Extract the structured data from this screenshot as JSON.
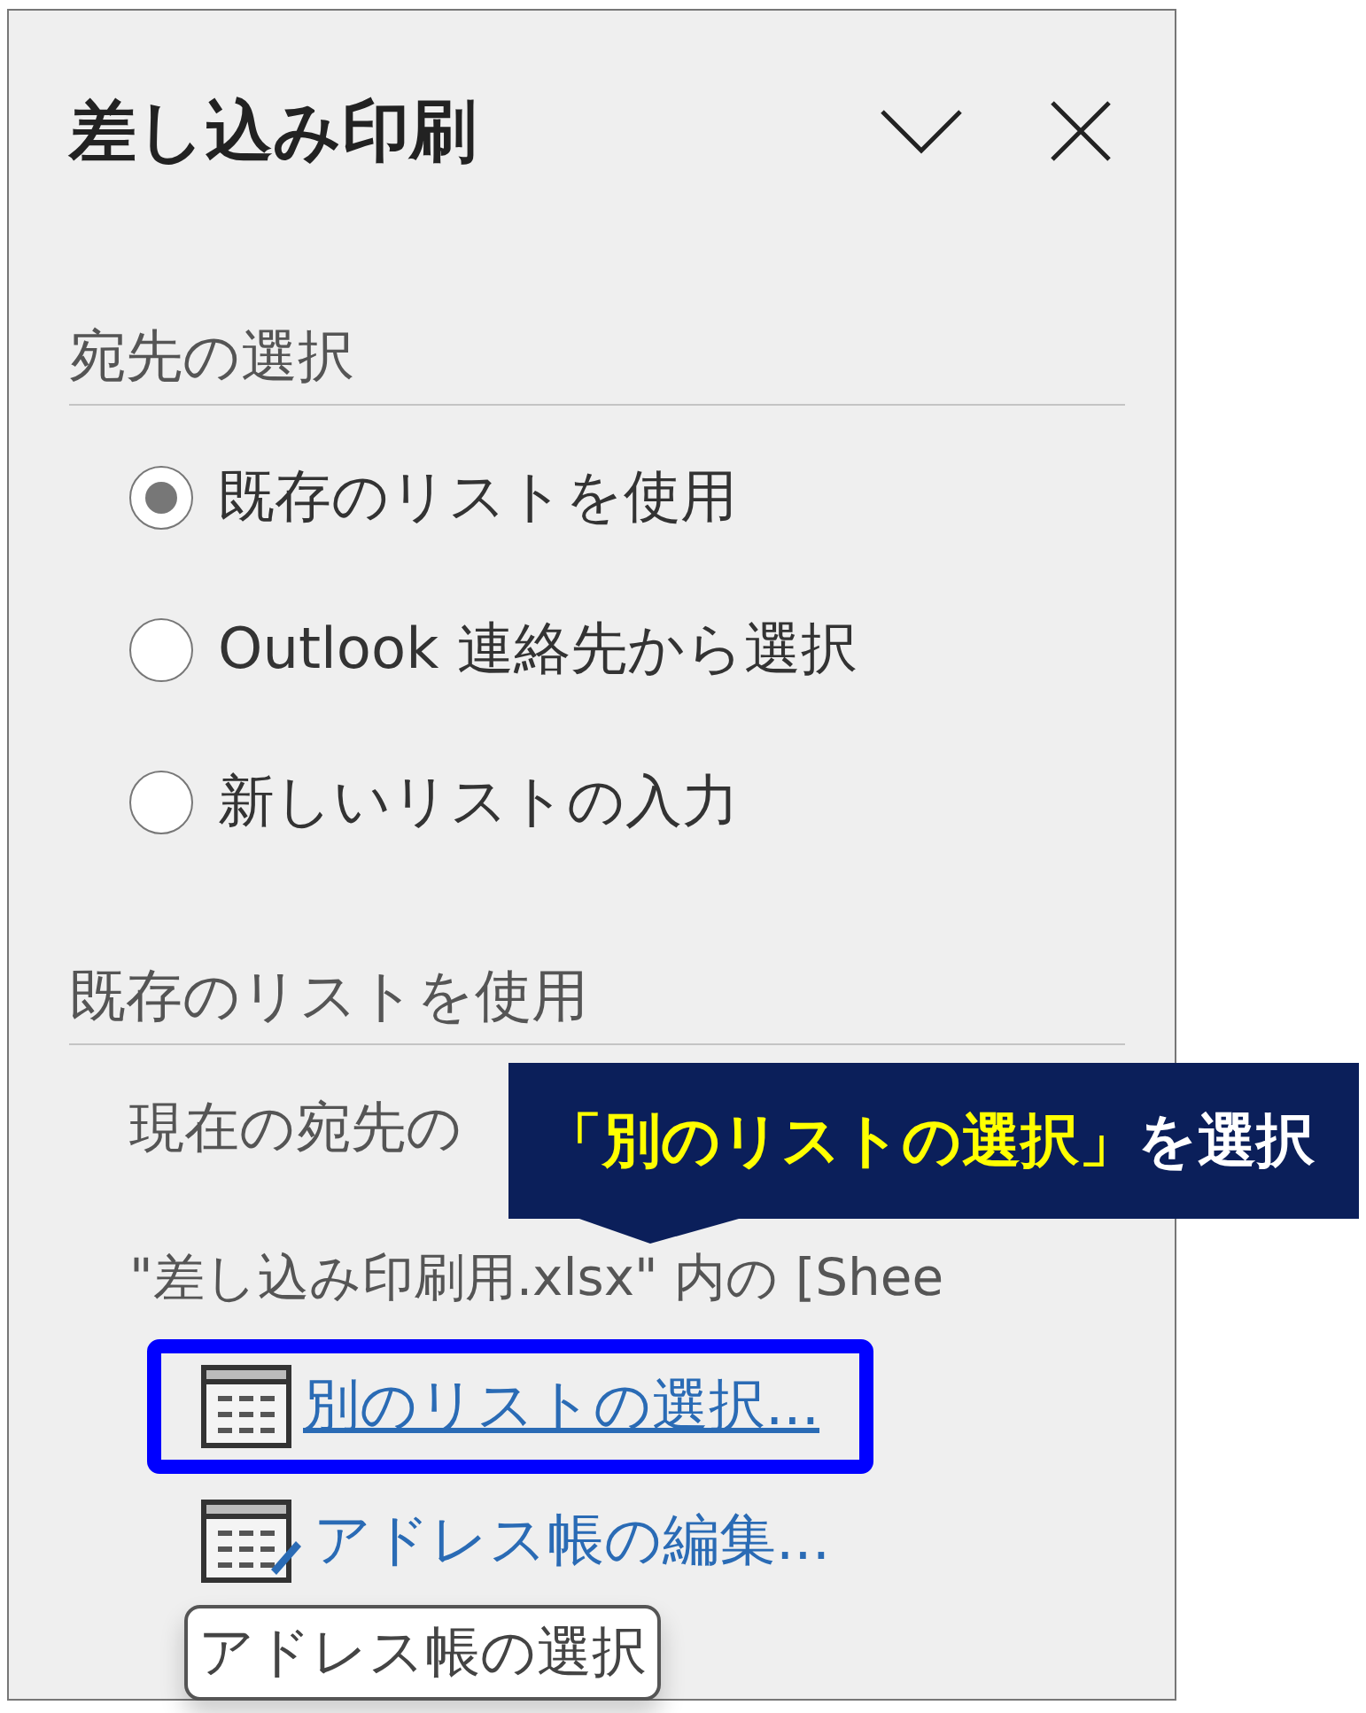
{
  "pane": {
    "title": "差し込み印刷"
  },
  "recipient_section": {
    "heading": "宛先の選択",
    "options": [
      {
        "label": "既存のリストを使用",
        "selected": true
      },
      {
        "label": "Outlook 連絡先から選択",
        "selected": false
      },
      {
        "label": "新しいリストの入力",
        "selected": false
      }
    ]
  },
  "list_section": {
    "heading": "既存のリストを使用",
    "lines": [
      "現在の宛先の",
      "\"差し込み印刷用.xlsx\" 内の [Shee"
    ],
    "links": [
      {
        "kind": "select",
        "label": "別のリストの選択...",
        "highlighted": true
      },
      {
        "kind": "edit",
        "label": "アドレス帳の編集...",
        "highlighted": false
      }
    ]
  },
  "tooltip": "アドレス帳の選択",
  "callout": {
    "highlight": "「別のリストの選択」",
    "rest": "を選択"
  }
}
